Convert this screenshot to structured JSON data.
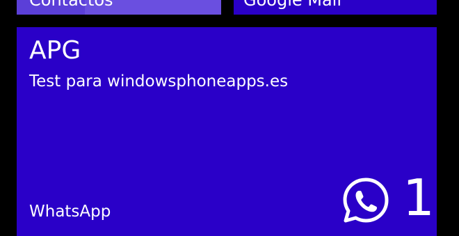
{
  "tiles": {
    "contactos": {
      "label": "Contactos"
    },
    "gmail": {
      "label": "Google Mail"
    },
    "whatsapp": {
      "sender": "APG",
      "message": "Test para windowsphoneapps.es",
      "app_name": "WhatsApp",
      "count": "1",
      "icon": "whatsapp-icon"
    }
  },
  "colors": {
    "background": "#000000",
    "tile_accent": "#2a00c8",
    "contactos_tile": "#5b3fd8",
    "text": "#ffffff"
  }
}
